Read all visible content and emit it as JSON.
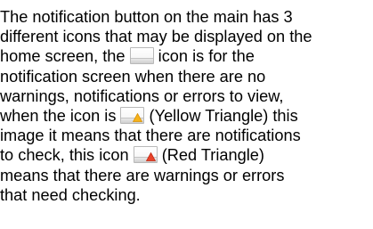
{
  "paragraph": {
    "lines": [
      "The notification button on the main has 3",
      "different icons that may be displayed on the",
      "home screen, the",
      "icon is for the",
      "notification screen when there are no",
      "warnings, notifications or errors to view,",
      "when the icon is",
      "(Yellow Triangle) this",
      "image it means that there are notifications",
      "to check, this icon",
      "(Red Triangle)",
      "means that there are warnings or errors",
      "that need checking."
    ]
  },
  "icons": {
    "blank": "notification-blank-icon",
    "yellow": "yellow-triangle-icon",
    "red": "red-triangle-icon"
  },
  "colors": {
    "yellow_triangle": "#f6b21a",
    "red_triangle": "#e8432a",
    "icon_border": "#b9b9b9"
  }
}
